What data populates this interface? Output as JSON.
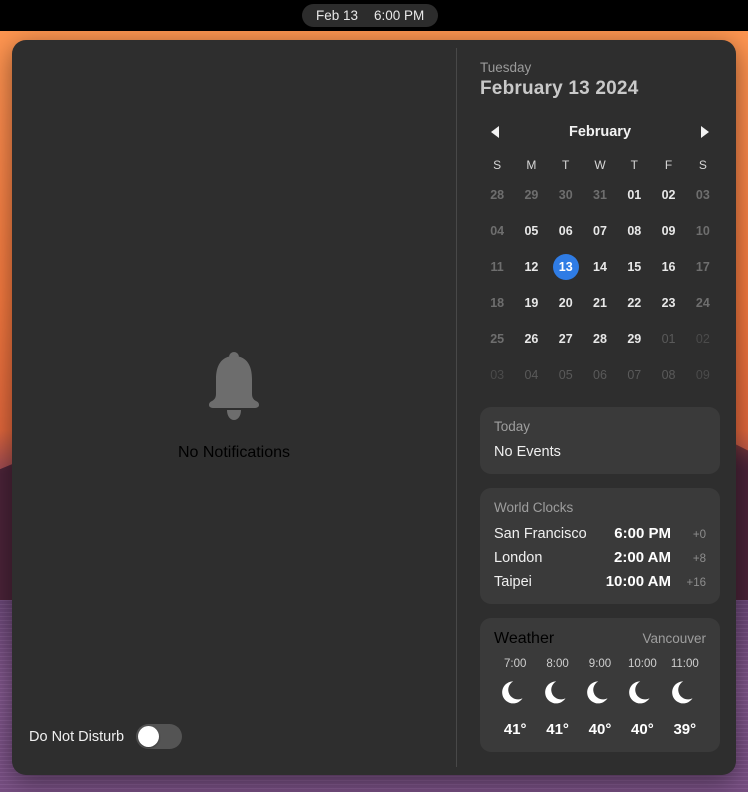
{
  "menubar": {
    "date": "Feb 13",
    "time": "6:00 PM"
  },
  "notifications": {
    "icon": "bell-icon",
    "empty_label": "No Notifications",
    "do_not_disturb": {
      "label": "Do Not Disturb",
      "enabled": false
    }
  },
  "widgets": {
    "date_header": {
      "weekday": "Tuesday",
      "full_date": "February 13 2024"
    },
    "calendar": {
      "month": "February",
      "prev_icon": "chevron-left-icon",
      "next_icon": "chevron-right-icon",
      "weekdays": [
        "S",
        "M",
        "T",
        "W",
        "T",
        "F",
        "S"
      ],
      "selected_day": "13",
      "accent_color": "#2f7ce5",
      "weeks": [
        [
          {
            "label": "28",
            "style": "dim"
          },
          {
            "label": "29",
            "style": "dim"
          },
          {
            "label": "30",
            "style": "dim"
          },
          {
            "label": "31",
            "style": "dim"
          },
          {
            "label": "01",
            "style": "normal"
          },
          {
            "label": "02",
            "style": "normal"
          },
          {
            "label": "03",
            "style": "dim"
          }
        ],
        [
          {
            "label": "04",
            "style": "dim"
          },
          {
            "label": "05",
            "style": "normal"
          },
          {
            "label": "06",
            "style": "normal"
          },
          {
            "label": "07",
            "style": "normal"
          },
          {
            "label": "08",
            "style": "normal"
          },
          {
            "label": "09",
            "style": "normal"
          },
          {
            "label": "10",
            "style": "dim"
          }
        ],
        [
          {
            "label": "11",
            "style": "dim"
          },
          {
            "label": "12",
            "style": "normal"
          },
          {
            "label": "13",
            "style": "selected"
          },
          {
            "label": "14",
            "style": "normal"
          },
          {
            "label": "15",
            "style": "normal"
          },
          {
            "label": "16",
            "style": "normal"
          },
          {
            "label": "17",
            "style": "dim"
          }
        ],
        [
          {
            "label": "18",
            "style": "dim"
          },
          {
            "label": "19",
            "style": "normal"
          },
          {
            "label": "20",
            "style": "normal"
          },
          {
            "label": "21",
            "style": "normal"
          },
          {
            "label": "22",
            "style": "normal"
          },
          {
            "label": "23",
            "style": "normal"
          },
          {
            "label": "24",
            "style": "dim"
          }
        ],
        [
          {
            "label": "25",
            "style": "dim"
          },
          {
            "label": "26",
            "style": "normal"
          },
          {
            "label": "27",
            "style": "normal"
          },
          {
            "label": "28",
            "style": "normal"
          },
          {
            "label": "29",
            "style": "normal"
          },
          {
            "label": "01",
            "style": "out"
          },
          {
            "label": "02",
            "style": "out-dim"
          }
        ],
        [
          {
            "label": "03",
            "style": "out-dim"
          },
          {
            "label": "04",
            "style": "out"
          },
          {
            "label": "05",
            "style": "out"
          },
          {
            "label": "06",
            "style": "out"
          },
          {
            "label": "07",
            "style": "out"
          },
          {
            "label": "08",
            "style": "out"
          },
          {
            "label": "09",
            "style": "out-dim"
          }
        ]
      ]
    },
    "today": {
      "title": "Today",
      "body": "No Events"
    },
    "world_clocks": {
      "title": "World Clocks",
      "rows": [
        {
          "city": "San Francisco",
          "time": "6:00 PM",
          "offset": "+0"
        },
        {
          "city": "London",
          "time": "2:00 AM",
          "offset": "+8"
        },
        {
          "city": "Taipei",
          "time": "10:00 AM",
          "offset": "+16"
        }
      ]
    },
    "weather": {
      "title": "Weather",
      "location": "Vancouver",
      "hours": [
        {
          "time": "7:00",
          "icon": "crescent-moon-icon",
          "temp": "41°"
        },
        {
          "time": "8:00",
          "icon": "crescent-moon-icon",
          "temp": "41°"
        },
        {
          "time": "9:00",
          "icon": "crescent-moon-icon",
          "temp": "40°"
        },
        {
          "time": "10:00",
          "icon": "crescent-moon-icon",
          "temp": "40°"
        },
        {
          "time": "11:00",
          "icon": "crescent-moon-icon",
          "temp": "39°"
        }
      ]
    }
  }
}
